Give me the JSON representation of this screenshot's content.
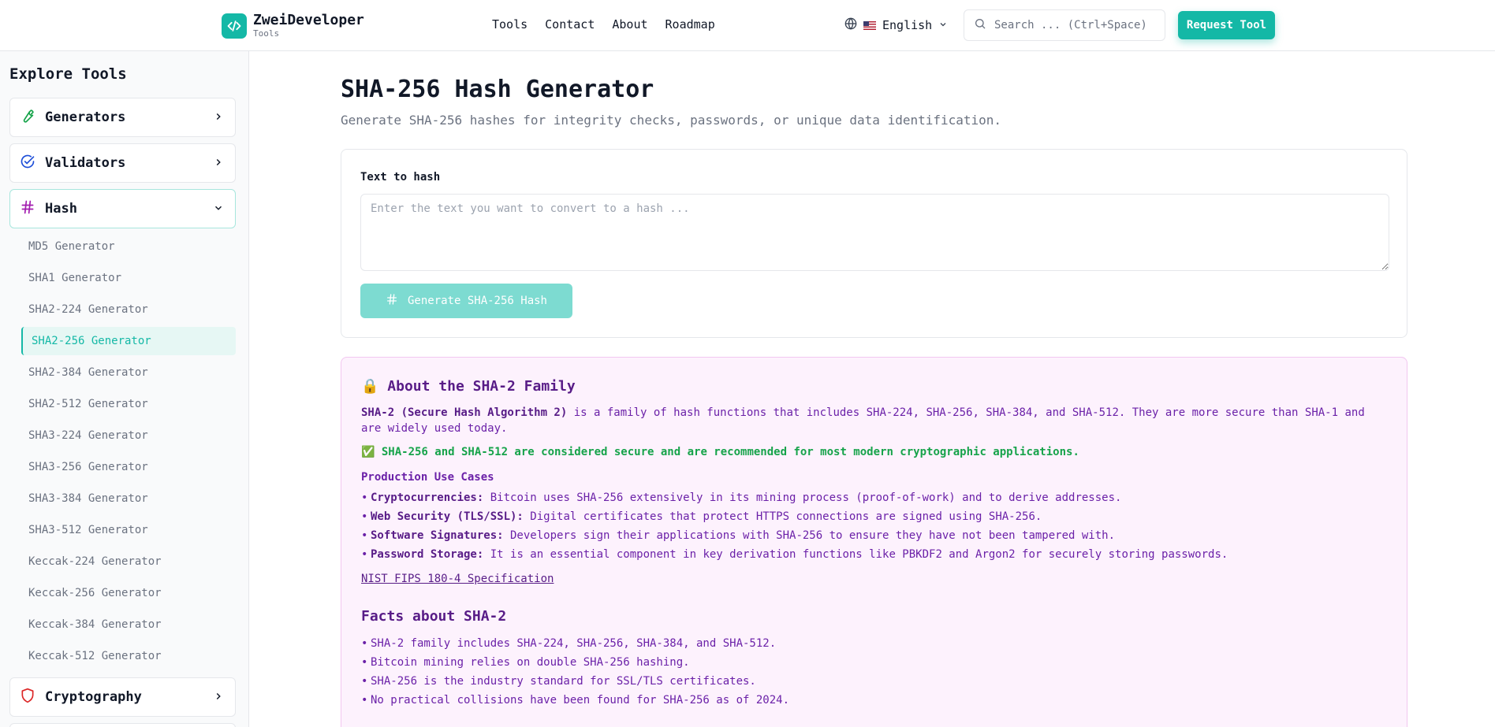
{
  "header": {
    "brand_name": "ZweiDeveloper",
    "brand_sub": "Tools",
    "nav": [
      "Tools",
      "Contact",
      "About",
      "Roadmap"
    ],
    "language": "English",
    "search_placeholder": "Search ... (Ctrl+Space)",
    "request_label": "Request Tool"
  },
  "sidebar": {
    "title": "Explore Tools",
    "categories": [
      {
        "label": "Generators",
        "icon": "wrench-icon",
        "color": "#16a34a"
      },
      {
        "label": "Validators",
        "icon": "check-circle-icon",
        "color": "#1d4ed8"
      },
      {
        "label": "Hash",
        "icon": "hash-icon",
        "color": "#a21caf"
      },
      {
        "label": "Cryptography",
        "icon": "shield-icon",
        "color": "#dc2626"
      }
    ],
    "hash_items": [
      "MD5 Generator",
      "SHA1 Generator",
      "SHA2-224 Generator",
      "SHA2-256 Generator",
      "SHA2-384 Generator",
      "SHA2-512 Generator",
      "SHA3-224 Generator",
      "SHA3-256 Generator",
      "SHA3-384 Generator",
      "SHA3-512 Generator",
      "Keccak-224 Generator",
      "Keccak-256 Generator",
      "Keccak-384 Generator",
      "Keccak-512 Generator"
    ],
    "active_item": "SHA2-256 Generator"
  },
  "main": {
    "title": "SHA-256 Hash Generator",
    "subtitle": "Generate SHA-256 hashes for integrity checks, passwords, or unique data identification.",
    "input_label": "Text to hash",
    "input_placeholder": "Enter the text you want to convert to a hash ...",
    "input_value": "",
    "button_label": "Generate SHA-256 Hash"
  },
  "info": {
    "title_emoji": "🔒",
    "title": "About the SHA-2 Family",
    "intro_bold": "SHA-2 (Secure Hash Algorithm 2)",
    "intro_rest": " is a family of hash functions that includes SHA-224, SHA-256, SHA-384, and SHA-512. They are more secure than SHA-1 and are widely used today.",
    "secure_note": "✅ SHA-256 and SHA-512 are considered secure and are recommended for most modern cryptographic applications.",
    "use_cases_title": "Production Use Cases",
    "use_cases": [
      {
        "bold": "Cryptocurrencies:",
        "text": " Bitcoin uses SHA-256 extensively in its mining process (proof-of-work) and to derive addresses."
      },
      {
        "bold": "Web Security (TLS/SSL):",
        "text": " Digital certificates that protect HTTPS connections are signed using SHA-256."
      },
      {
        "bold": "Software Signatures:",
        "text": " Developers sign their applications with SHA-256 to ensure they have not been tampered with."
      },
      {
        "bold": "Password Storage:",
        "text": " It is an essential component in key derivation functions like PBKDF2 and Argon2 for securely storing passwords."
      }
    ],
    "spec_link": "NIST FIPS 180-4 Specification",
    "facts_title": "Facts about SHA-2",
    "facts": [
      "SHA-2 family includes SHA-224, SHA-256, SHA-384, and SHA-512.",
      "Bitcoin mining relies on double SHA-256 hashing.",
      "SHA-256 is the industry standard for SSL/TLS certificates.",
      "No practical collisions have been found for SHA-256 as of 2024."
    ]
  }
}
